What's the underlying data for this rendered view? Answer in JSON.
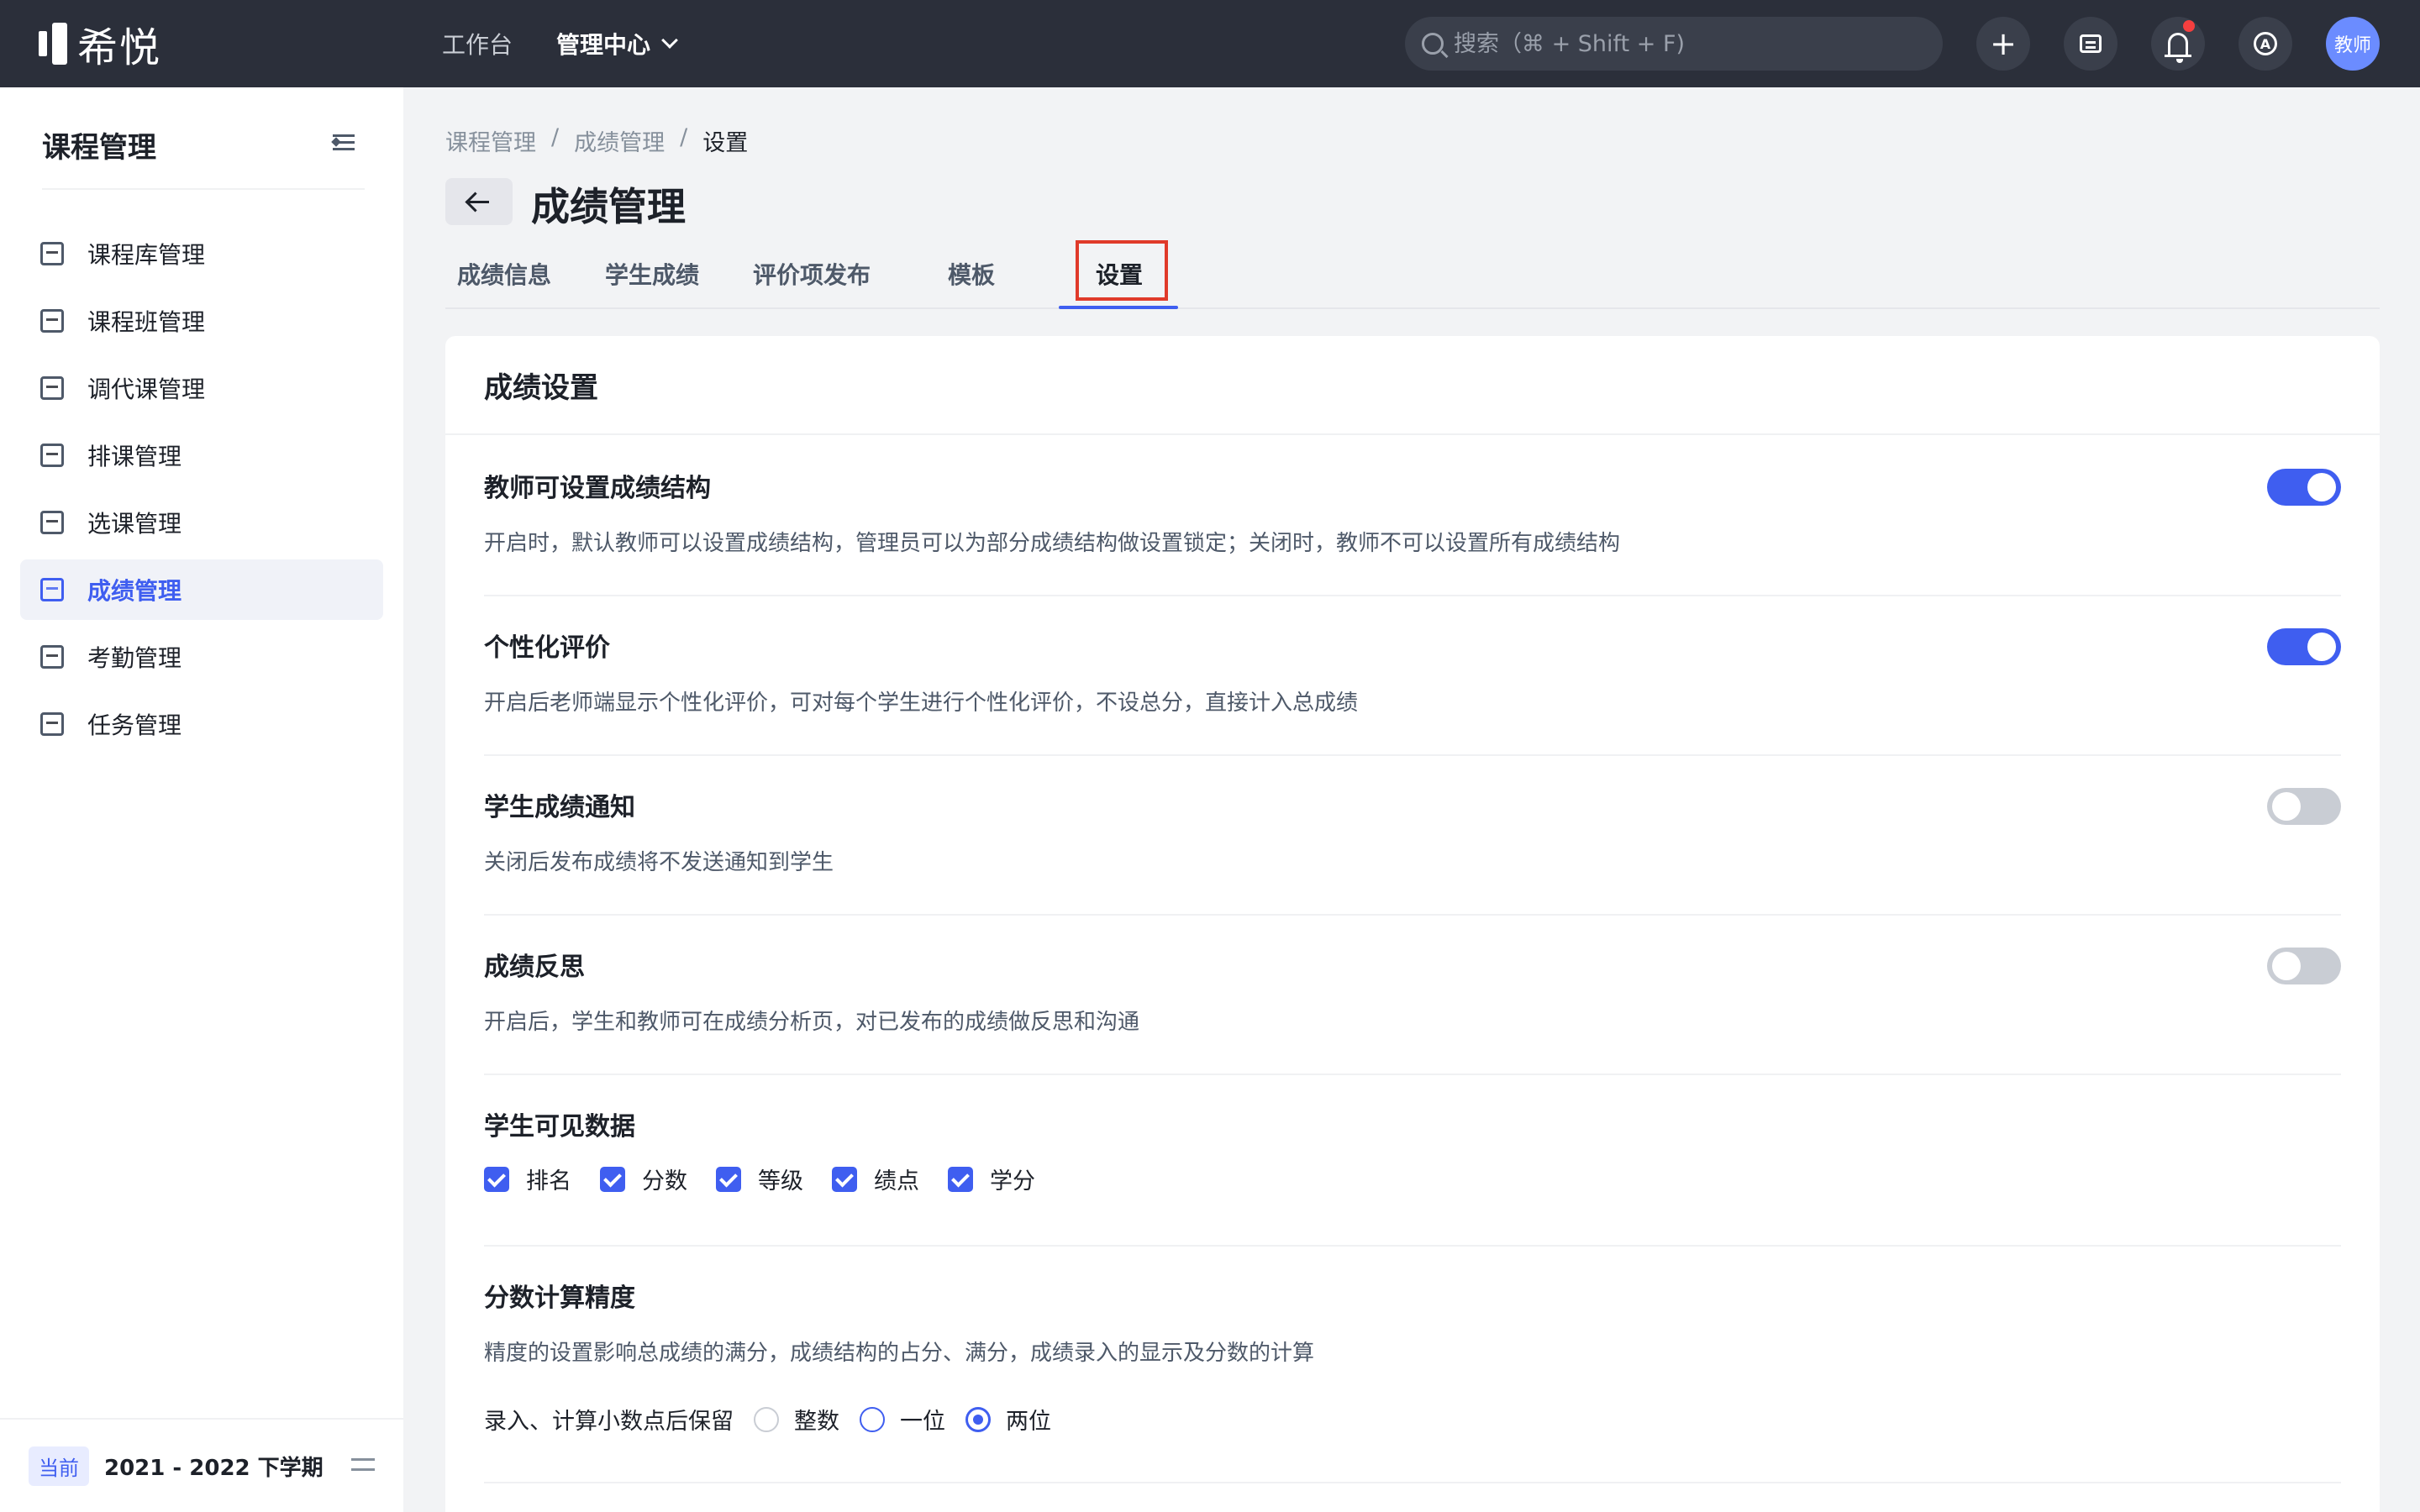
{
  "app": {
    "logo_text": "希悦"
  },
  "topnav": {
    "items": [
      {
        "label": "工作台"
      },
      {
        "label": "管理中心"
      }
    ]
  },
  "search": {
    "placeholder": "搜索（⌘ + Shift + F)"
  },
  "header_icons": [
    "plus-icon",
    "message-icon",
    "bell-icon",
    "help-icon"
  ],
  "avatar": {
    "label": "教师",
    "color": "#6b8cff"
  },
  "sidebar": {
    "title": "课程管理",
    "items": [
      {
        "label": "课程库管理",
        "icon": "course-library-icon"
      },
      {
        "label": "课程班管理",
        "icon": "course-class-icon"
      },
      {
        "label": "调代课管理",
        "icon": "substitute-icon"
      },
      {
        "label": "排课管理",
        "icon": "schedule-icon"
      },
      {
        "label": "选课管理",
        "icon": "select-course-icon"
      },
      {
        "label": "成绩管理",
        "icon": "grade-icon",
        "active": true
      },
      {
        "label": "考勤管理",
        "icon": "attendance-icon"
      },
      {
        "label": "任务管理",
        "icon": "task-icon"
      }
    ],
    "footer": {
      "badge": "当前",
      "term": "2021 - 2022 下学期"
    }
  },
  "breadcrumb": [
    "课程管理",
    "成绩管理",
    "设置"
  ],
  "breadcrumb_sep": "/",
  "page_title": "成绩管理",
  "tabs": [
    {
      "label": "成绩信息"
    },
    {
      "label": "学生成绩"
    },
    {
      "label": "评价项发布"
    },
    {
      "label": "模板"
    },
    {
      "label": "设置",
      "active": true
    }
  ],
  "card": {
    "title": "成绩设置",
    "settings": [
      {
        "title": "教师可设置成绩结构",
        "desc": "开启时，默认教师可以设置成绩结构，管理员可以为部分成绩结构做设置锁定；关闭时，教师不可以设置所有成绩结构",
        "enabled": true
      },
      {
        "title": "个性化评价",
        "desc": "开启后老师端显示个性化评价，可对每个学生进行个性化评价，不设总分，直接计入总成绩",
        "enabled": true
      },
      {
        "title": "学生成绩通知",
        "desc": "关闭后发布成绩将不发送通知到学生",
        "enabled": false
      },
      {
        "title": "成绩反思",
        "desc": "开启后，学生和教师可在成绩分析页，对已发布的成绩做反思和沟通",
        "enabled": false
      }
    ],
    "visible_data": {
      "title": "学生可见数据",
      "options": [
        {
          "label": "排名",
          "checked": true
        },
        {
          "label": "分数",
          "checked": true
        },
        {
          "label": "等级",
          "checked": true
        },
        {
          "label": "绩点",
          "checked": true
        },
        {
          "label": "学分",
          "checked": true
        }
      ]
    },
    "precision": {
      "title": "分数计算精度",
      "desc": "精度的设置影响总成绩的满分，成绩结构的占分、满分，成绩录入的显示及分数的计算",
      "label": "录入、计算小数点后保留",
      "options": [
        {
          "label": "整数"
        },
        {
          "label": "一位"
        },
        {
          "label": "两位"
        }
      ],
      "selected": "两位"
    }
  },
  "colors": {
    "accent": "#3f5ef0",
    "topbar": "#2b2f3a",
    "highlight_box": "#e03a2a"
  }
}
